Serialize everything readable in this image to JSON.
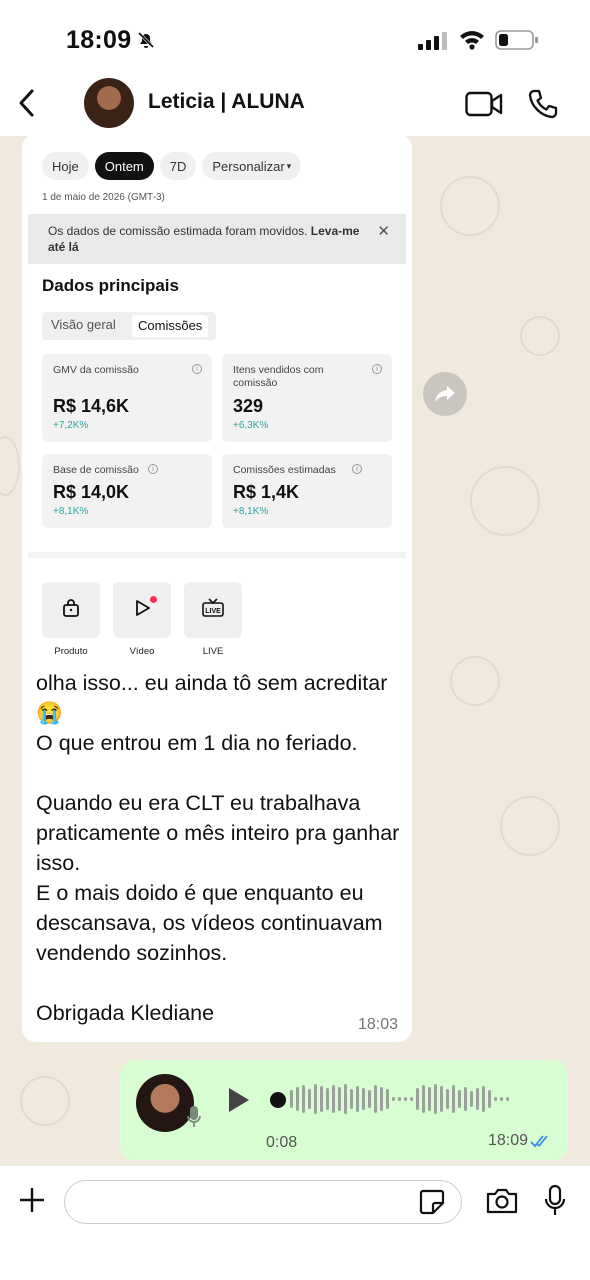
{
  "status_bar": {
    "time": "18:09",
    "mute_icon": "bell-slash-icon",
    "signal_icon": "cellular-signal-icon",
    "wifi_icon": "wifi-icon",
    "battery_icon": "battery-low-icon"
  },
  "header": {
    "contact_name": "Leticia | ALUNA",
    "back_icon": "chevron-left-icon",
    "video_icon": "video-camera-icon",
    "call_icon": "phone-icon"
  },
  "incoming_message": {
    "screenshot": {
      "pills": [
        "Hoje",
        "Ontem",
        "7D",
        "Personalizar"
      ],
      "active_pill": "Ontem",
      "date": "1 de maio de 2026 (GMT-3)",
      "notice_text": "Os dados de comissão estimada foram movidos. ",
      "notice_link": "Leva-me até lá",
      "section_title": "Dados principais",
      "segments": [
        "Visão geral",
        "Comissões"
      ],
      "active_segment": "Comissões",
      "cards": [
        {
          "label": "GMV da comissão",
          "value": "R$ 14,6K",
          "change": "+7,2K%"
        },
        {
          "label": "Itens vendidos com comissão",
          "value": "329",
          "change": "+6,3K%"
        },
        {
          "label": "Base de comissão",
          "value": "R$ 14,0K",
          "change": "+8,1K%"
        },
        {
          "label": "Comissões estimadas",
          "value": "R$ 1,4K",
          "change": "+8,1K%"
        }
      ],
      "tools": [
        {
          "label": "Produto",
          "icon": "shopping-bag-icon"
        },
        {
          "label": "Vídeo",
          "icon": "play-icon"
        },
        {
          "label": "LIVE",
          "icon": "live-tv-icon"
        }
      ]
    },
    "text": "olha isso... eu ainda tô sem acreditar 😭\nO que entrou em 1 dia no feriado.\n\nQuando eu era CLT eu trabalhava praticamente o mês inteiro pra ganhar isso.\nE o mais doido é que enquanto eu descansava, os vídeos continuavam vendendo sozinhos.\n\nObrigada Klediane",
    "time": "18:03"
  },
  "outgoing_voice": {
    "duration": "0:08",
    "time": "18:09",
    "status_icon": "double-check-icon"
  },
  "composer": {
    "input_value": "",
    "plus_icon": "plus-icon",
    "sticker_icon": "sticker-icon",
    "camera_icon": "camera-icon",
    "mic_icon": "microphone-icon"
  }
}
